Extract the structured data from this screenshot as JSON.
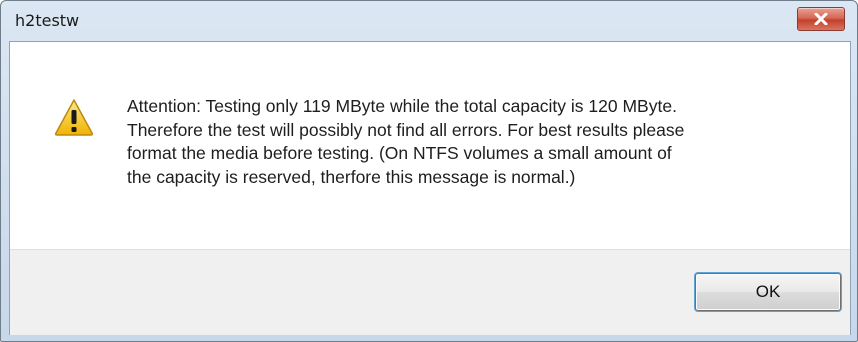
{
  "window": {
    "title": "h2testw",
    "close_icon": "close-icon"
  },
  "dialog": {
    "icon": "warning-icon",
    "message_lines": [
      "Attention: Testing only 119 MByte while the total capacity is 120 MByte.",
      "Therefore the test will possibly not find all errors. For best results please",
      "format the media before testing. (On NTFS volumes a small amount of",
      "the capacity is reserved, therfore this message is normal.)"
    ],
    "ok_label": "OK"
  },
  "colors": {
    "warning_fill": "#f7c52b",
    "close_button": "#c4412b",
    "focus_ring": "#5da5d8"
  }
}
